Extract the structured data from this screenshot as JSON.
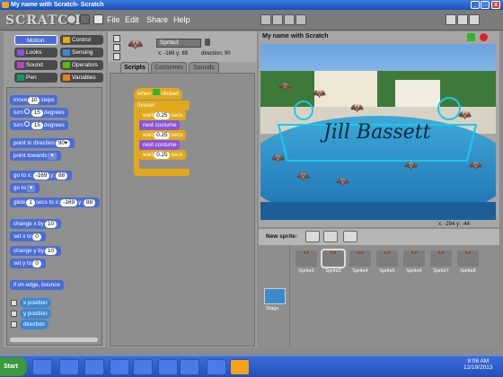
{
  "window": {
    "title": "My name with Scratch- Scratch",
    "controls": [
      "_",
      "□",
      "x"
    ]
  },
  "app": {
    "logo": "SCRATCH"
  },
  "menu": {
    "items": [
      "File",
      "Edit",
      "Share",
      "Help"
    ]
  },
  "categories": [
    {
      "label": "Motion",
      "color": "#4a6cd4"
    },
    {
      "label": "Control",
      "color": "#e1a91a"
    },
    {
      "label": "Looks",
      "color": "#8a55d7"
    },
    {
      "label": "Sensing",
      "color": "#3b87d3"
    },
    {
      "label": "Sound",
      "color": "#bb42c3"
    },
    {
      "label": "Operators",
      "color": "#5cb712"
    },
    {
      "label": "Pen",
      "color": "#0e9a6c"
    },
    {
      "label": "Variables",
      "color": "#ee7d16"
    }
  ],
  "palette_blocks": {
    "move": {
      "pre": "move",
      "val": "10",
      "post": "steps"
    },
    "turn_cw": {
      "pre": "turn",
      "val": "15",
      "post": "degrees"
    },
    "turn_ccw": {
      "pre": "turn",
      "val": "15",
      "post": "degrees"
    },
    "point_dir": {
      "pre": "point in direction",
      "val": "90▾"
    },
    "point_towards": {
      "pre": "point towards",
      "val": "▾"
    },
    "goto_xy": {
      "pre": "go to x:",
      "x": "-169",
      "ymid": "y:",
      "y": "88"
    },
    "goto": {
      "pre": "go to",
      "val": "▾"
    },
    "glide": {
      "pre": "glide",
      "secs": "1",
      "mid": "secs to x:",
      "x": "-169",
      "ymid": "y:",
      "y": "88"
    },
    "change_x": {
      "pre": "change x by",
      "val": "10"
    },
    "set_x": {
      "pre": "set x to",
      "val": "0"
    },
    "change_y": {
      "pre": "change y by",
      "val": "10"
    },
    "set_y": {
      "pre": "set y to",
      "val": "0"
    },
    "bounce": {
      "label": "if on edge, bounce"
    },
    "reporters": [
      "x position",
      "y position",
      "direction"
    ]
  },
  "sprite_info": {
    "name": "Sprite3",
    "x": "x: -169",
    "y": "y: 88",
    "direction": "direction: 90"
  },
  "tabs": [
    "Scripts",
    "Costumes",
    "Sounds"
  ],
  "script": {
    "hat": "when",
    "hat_post": "clicked",
    "forever": "forever",
    "wait_pre": "wait",
    "wait_val": "0.25",
    "wait_post": "secs",
    "next": "next costume"
  },
  "stage": {
    "title": "My name with Scratch",
    "text": "Jill Bassett",
    "coords": "x: -294   y: -44"
  },
  "sprites": {
    "new_label": "New sprite:",
    "list": [
      "Sprite2",
      "Sprite3",
      "Sprite4",
      "Sprite5",
      "Sprite6",
      "Sprite7",
      "Sprite8"
    ],
    "selected": "Sprite3",
    "stage_label": "Stage"
  },
  "taskbar": {
    "start": "Start",
    "time": "9:06 AM",
    "date": "12/19/2013"
  },
  "colors": {
    "motion": "#4a6cd4",
    "control": "#e1a91a",
    "looks": "#8a55d7",
    "green_flag": "#2fb52f",
    "stop": "#e02020"
  }
}
